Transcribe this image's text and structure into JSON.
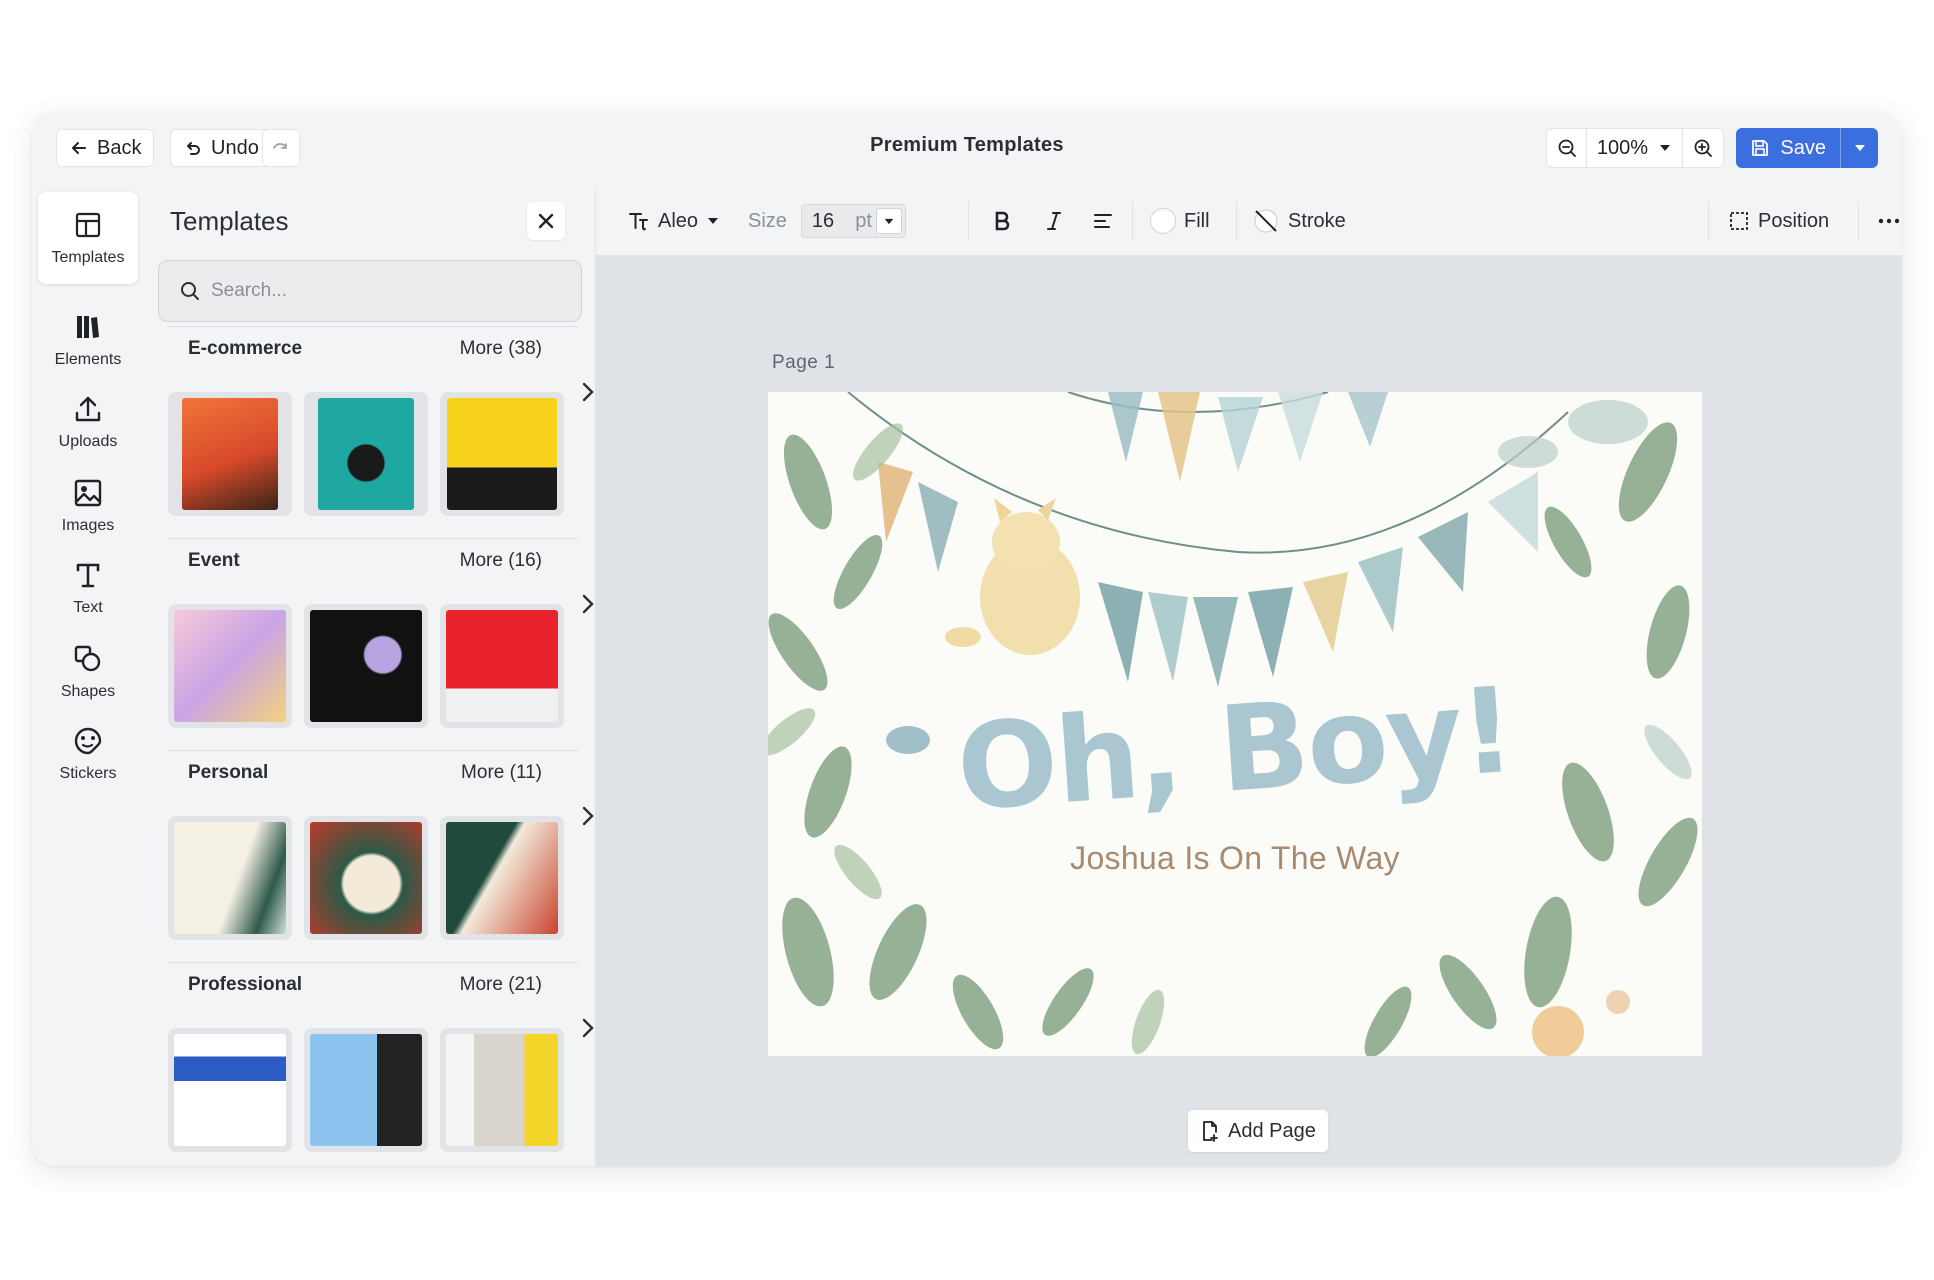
{
  "topbar": {
    "back_label": "Back",
    "undo_label": "Undo",
    "title": "Premium Templates",
    "zoom_value": "100%",
    "save_label": "Save"
  },
  "rail": {
    "items": [
      {
        "label": "Templates",
        "icon": "layout-icon"
      },
      {
        "label": "Elements",
        "icon": "elements-icon"
      },
      {
        "label": "Uploads",
        "icon": "upload-icon"
      },
      {
        "label": "Images",
        "icon": "image-icon"
      },
      {
        "label": "Text",
        "icon": "text-icon"
      },
      {
        "label": "Shapes",
        "icon": "shapes-icon"
      },
      {
        "label": "Stickers",
        "icon": "sticker-icon"
      }
    ]
  },
  "panel": {
    "title": "Templates",
    "search_placeholder": "Search...",
    "categories": [
      {
        "name": "E-commerce",
        "more": "More (38)"
      },
      {
        "name": "Event",
        "more": "More (16)"
      },
      {
        "name": "Personal",
        "more": "More (11)"
      },
      {
        "name": "Professional",
        "more": "More (21)"
      }
    ]
  },
  "toolbar": {
    "font_name": "Aleo",
    "size_label": "Size",
    "size_value": "16",
    "size_unit": "pt",
    "fill_label": "Fill",
    "stroke_label": "Stroke",
    "position_label": "Position"
  },
  "canvas": {
    "page_label": "Page  1",
    "headline": "Oh, Boy!",
    "subline": "Joshua Is On The Way",
    "add_page_label": "Add Page"
  },
  "colors": {
    "accent": "#3b6fe0",
    "headline": "#a9c6d1",
    "subline": "#a98a6e"
  }
}
